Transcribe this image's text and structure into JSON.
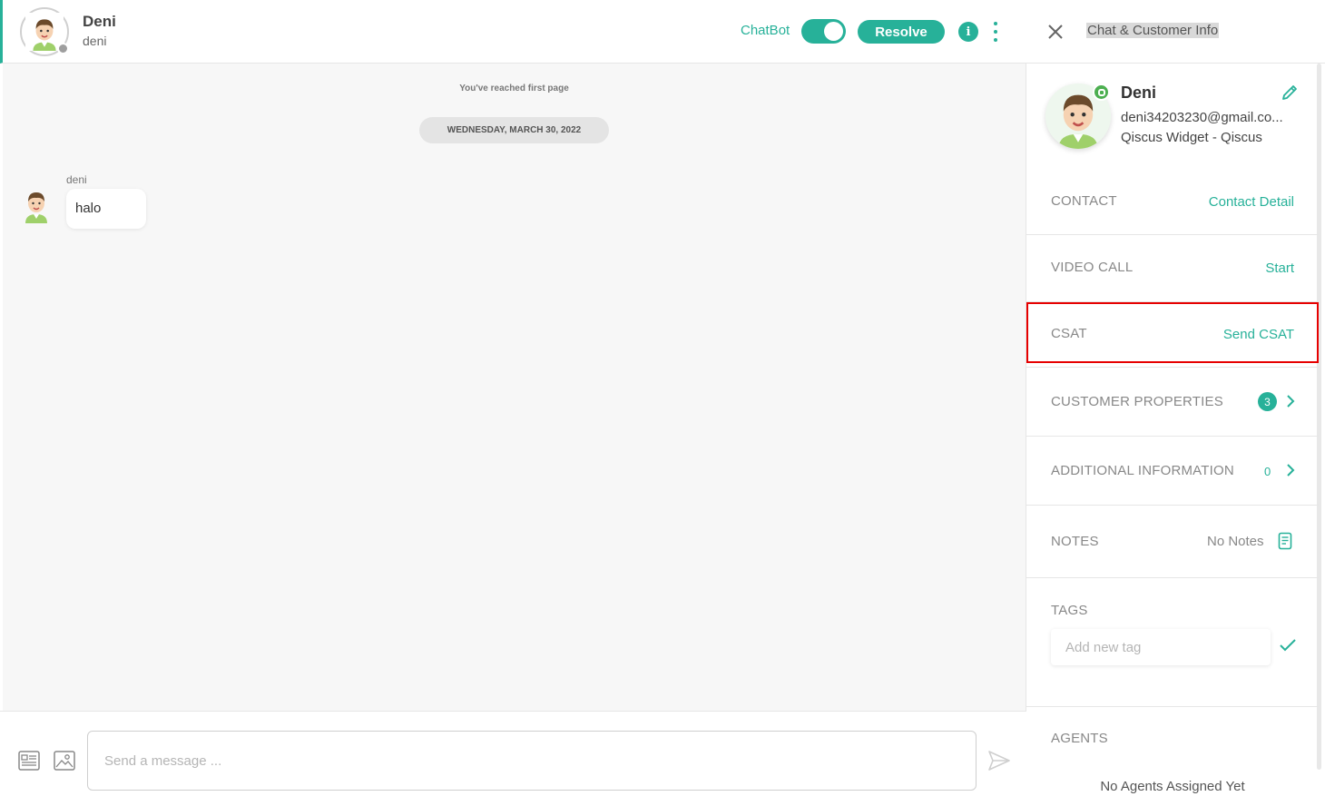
{
  "header": {
    "contact_name": "Deni",
    "contact_sub": "deni",
    "chatbot_label": "ChatBot",
    "chatbot_enabled": true,
    "resolve_label": "Resolve",
    "info_glyph": "i"
  },
  "conversation": {
    "first_page_notice": "You've reached first page",
    "date_separator": "WEDNESDAY, MARCH 30, 2022",
    "messages": [
      {
        "sender": "deni",
        "text": "halo"
      }
    ]
  },
  "composer": {
    "placeholder": "Send a message ..."
  },
  "panel": {
    "title": "Chat & Customer Info",
    "profile": {
      "name": "Deni",
      "email": "deni34203230@gmail.co...",
      "source": "Qiscus Widget - Qiscus"
    },
    "contact": {
      "label": "CONTACT",
      "action": "Contact Detail"
    },
    "video_call": {
      "label": "VIDEO CALL",
      "action": "Start"
    },
    "csat": {
      "label": "CSAT",
      "action": "Send CSAT"
    },
    "customer_properties": {
      "label": "CUSTOMER PROPERTIES",
      "count": "3"
    },
    "additional_information": {
      "label": "ADDITIONAL INFORMATION",
      "count": "0"
    },
    "notes": {
      "label": "NOTES",
      "value": "No Notes"
    },
    "tags": {
      "label": "TAGS",
      "placeholder": "Add new tag"
    },
    "agents": {
      "label": "AGENTS",
      "empty_text": "No Agents Assigned Yet"
    }
  },
  "colors": {
    "accent": "#27b199",
    "highlight": "#e60000",
    "status_offline": "#9e9e9e",
    "channel_badge": "#4caf50"
  },
  "icons": [
    "avatar-boy-icon",
    "info-icon",
    "kebab-menu-icon",
    "template-icon",
    "image-icon",
    "send-icon",
    "close-icon",
    "edit-pencil-icon",
    "chevron-right-icon",
    "notes-icon",
    "check-icon"
  ]
}
